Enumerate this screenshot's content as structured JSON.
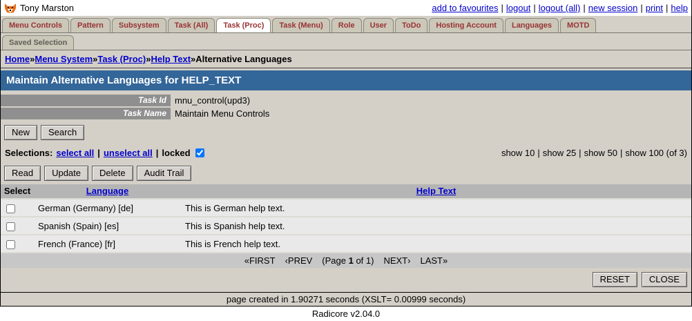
{
  "header": {
    "user_name": "Tony Marston",
    "separator": "|",
    "links": [
      "add to favourites",
      "logout",
      "logout (all)",
      "new session",
      "print",
      "help"
    ]
  },
  "tabs": {
    "row1": [
      "Menu Controls",
      "Pattern",
      "Subsystem",
      "Task (All)",
      "Task (Proc)",
      "Task (Menu)",
      "Role",
      "User",
      "ToDo",
      "Hosting Account",
      "Languages",
      "MOTD"
    ],
    "active": "Task (Proc)",
    "row2": [
      "Saved Selection"
    ]
  },
  "breadcrumb": {
    "separator": "»",
    "links": [
      "Home",
      "Menu System",
      "Task (Proc)",
      "Help Text"
    ],
    "current": "Alternative Languages"
  },
  "title": "Maintain Alternative Languages for HELP_TEXT",
  "details": [
    {
      "label": "Task Id",
      "value": "mnu_control(upd3)"
    },
    {
      "label": "Task Name",
      "value": "Maintain Menu Controls"
    }
  ],
  "toolbar_top": [
    "New",
    "Search"
  ],
  "selections": {
    "label": "Selections:",
    "select_all": "select all",
    "unselect_all": "unselect all",
    "locked_label": "locked",
    "locked_checked": true,
    "separator": "|",
    "show_options": [
      "show 10",
      "show 25",
      "show 50",
      "show 100"
    ],
    "total": "(of 3)"
  },
  "toolbar_actions": [
    "Read",
    "Update",
    "Delete",
    "Audit Trail"
  ],
  "table": {
    "headers": [
      "Select",
      "Language",
      "Help Text"
    ],
    "rows": [
      {
        "language": "German (Germany) [de]",
        "help_text": "This is German help text."
      },
      {
        "language": "Spanish (Spain) [es]",
        "help_text": "This is Spanish help text."
      },
      {
        "language": "French (France) [fr]",
        "help_text": "This is French help text."
      }
    ]
  },
  "pagination": {
    "first": "«FIRST",
    "prev": "‹PREV",
    "page_pre": "(Page",
    "page_num": "1",
    "page_post": "of 1)",
    "next": "NEXT›",
    "last": "LAST»"
  },
  "footer_buttons": [
    "RESET",
    "CLOSE"
  ],
  "footer": {
    "timing": "page created in 1.90271 seconds (XSLT= 0.00999 seconds)",
    "version": "Radicore v2.04.0"
  },
  "colors": {
    "title_bar": "#336699",
    "link": "#0000CC",
    "tab_text": "#993333",
    "page_background": "#D4D0C8",
    "table_header": "#B5B5B5",
    "label_bar": "#8F8F8F"
  }
}
